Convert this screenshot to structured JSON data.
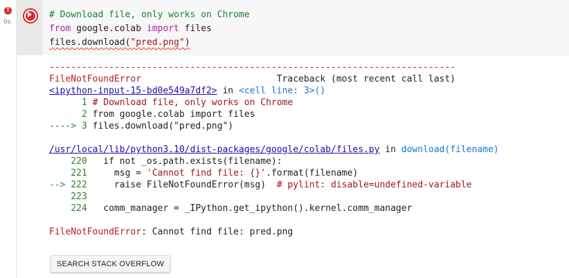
{
  "gutter": {
    "error_badge": "!",
    "exec_time": "0s"
  },
  "code": {
    "line1": "# Download file, only works on Chrome",
    "line2_kw1": "from",
    "line2_mod": " google.colab ",
    "line2_kw2": "import",
    "line2_rest": " files",
    "line3_pre": "files.download(",
    "line3_str": "\"pred.png\"",
    "line3_post": ")"
  },
  "output": {
    "dashes": "---------------------------------------------------------------------------",
    "error_name": "FileNotFoundError",
    "traceback_label": "                         Traceback (most recent call last)",
    "input_link": "<ipython-input-15-bd0e549a7df2>",
    "in_word": " in ",
    "cell_line": "<cell line: 3>()",
    "tb_line1_num": "      1 ",
    "tb_line1_text": "# Download file, only works on Chrome",
    "tb_line2_num": "      2 ",
    "tb_line2_text": "from google.colab import files",
    "tb_line3_arrow": "----> 3 ",
    "tb_line3_text": "files.download(\"pred.png\")",
    "file_link": "/usr/local/lib/python3.10/dist-packages/google/colab/files.py",
    "in_word2": " in ",
    "func_name": "download",
    "func_args": "(filename)",
    "src220_num": "    220 ",
    "src220_text": "  if not _os.path.exists(filename):",
    "src221_num": "    221 ",
    "src221_pre": "    msg = ",
    "src221_str": "'Cannot find file: {}'",
    "src221_post": ".format(filename)",
    "src222_arrow": "--> 222 ",
    "src222_pre": "    raise FileNotFoundError(msg)  ",
    "src222_comment": "# pylint: disable=undefined-variable",
    "src223_num": "    223 ",
    "src224_num": "    224 ",
    "src224_text": "  comm_manager = _IPython.get_ipython().kernel.comm_manager",
    "final_error_name": "FileNotFoundError",
    "final_error_msg": ": Cannot find file: pred.png"
  },
  "search_button_label": "SEARCH STACK OVERFLOW"
}
